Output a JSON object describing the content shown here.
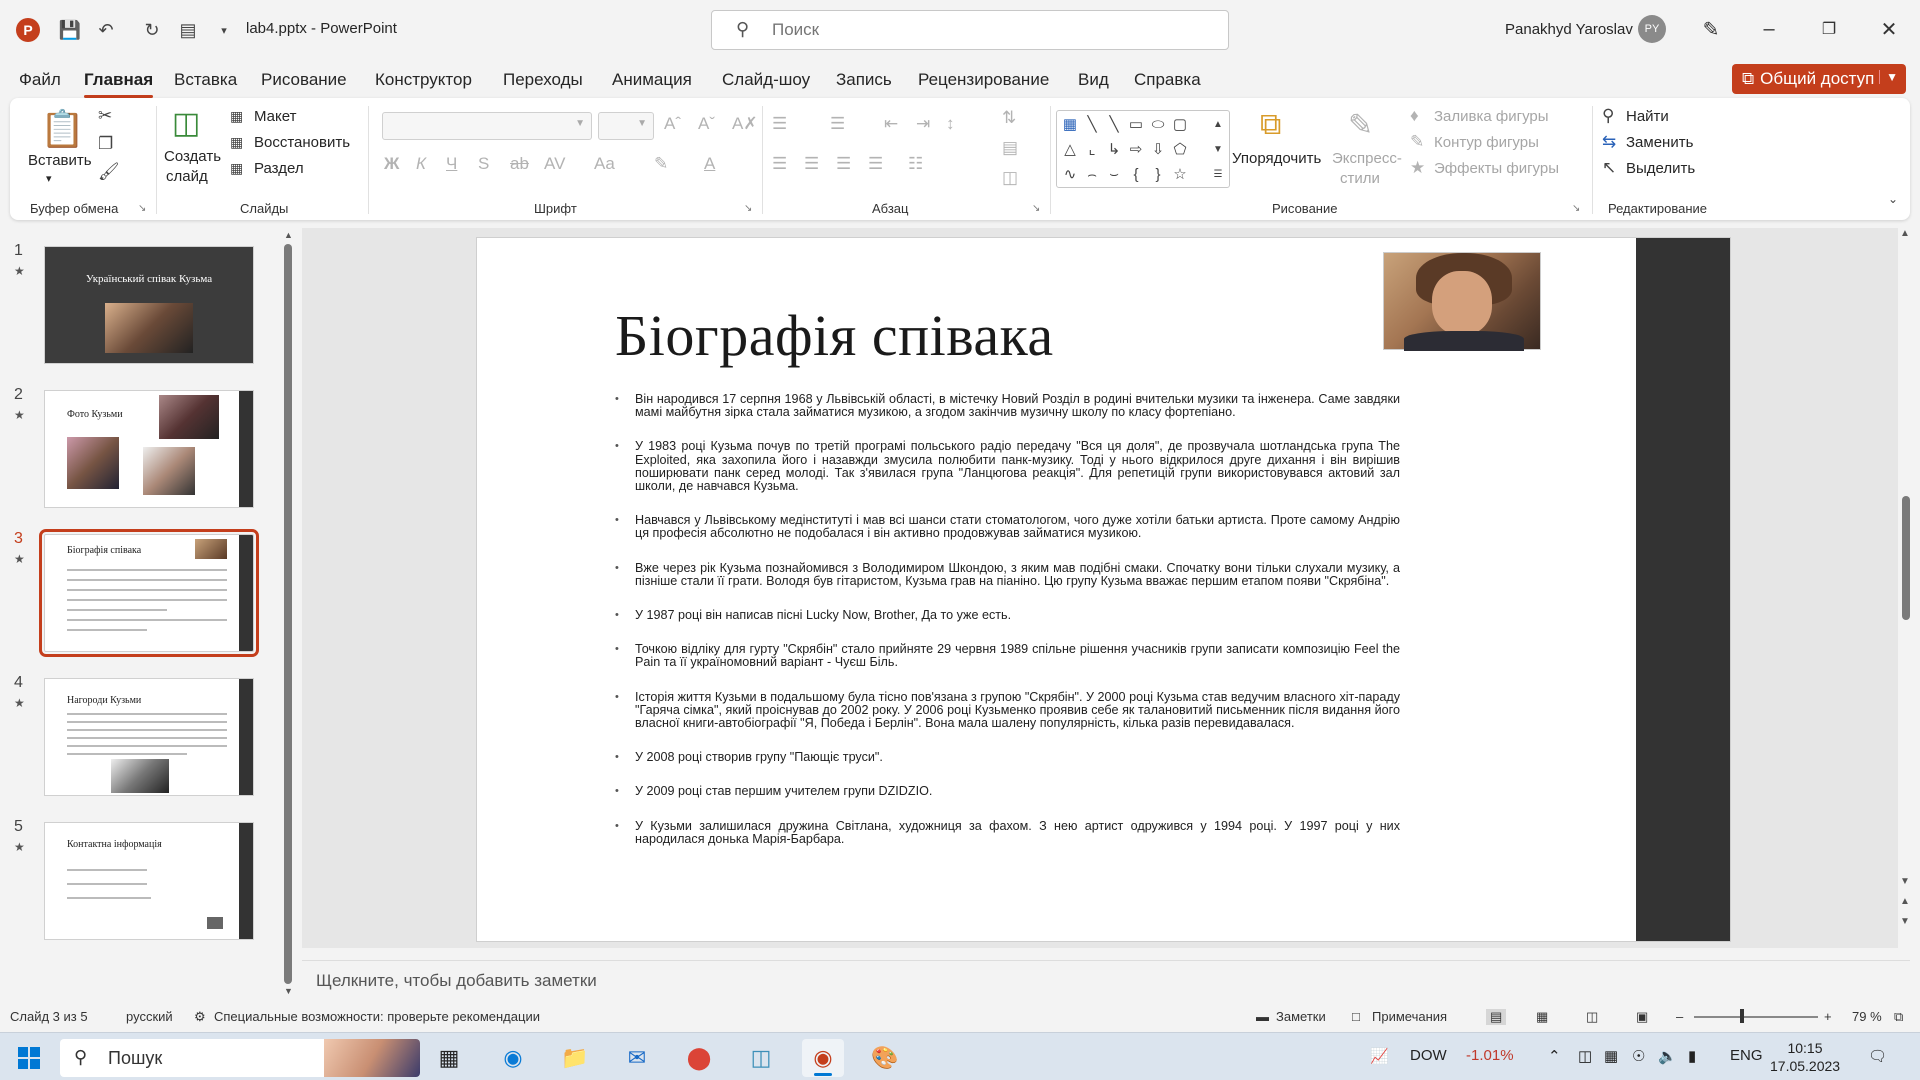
{
  "window": {
    "doc_title": "lab4.pptx  -  PowerPoint",
    "search_placeholder": "Поиск",
    "user_name": "Panakhyd Yaroslav",
    "user_initials": "PY"
  },
  "menu": {
    "tabs": [
      "Файл",
      "Главная",
      "Вставка",
      "Рисование",
      "Конструктор",
      "Переходы",
      "Анимация",
      "Слайд-шоу",
      "Запись",
      "Рецензирование",
      "Вид",
      "Справка"
    ],
    "active_tab": "Главная",
    "share_label": "Общий доступ"
  },
  "ribbon": {
    "clipboard": {
      "paste": "Вставить",
      "group": "Буфер обмена"
    },
    "slides": {
      "new_slide_1": "Создать",
      "new_slide_2": "слайд",
      "layout": "Макет",
      "reset": "Восстановить",
      "section": "Раздел",
      "group": "Слайды"
    },
    "font": {
      "group": "Шрифт"
    },
    "paragraph": {
      "group": "Абзац"
    },
    "drawing": {
      "arrange": "Упорядочить",
      "quick_styles_1": "Экспресс-",
      "quick_styles_2": "стили",
      "fill": "Заливка фигуры",
      "outline": "Контур фигуры",
      "effects": "Эффекты фигуры",
      "group": "Рисование"
    },
    "editing": {
      "find": "Найти",
      "replace": "Заменить",
      "select": "Выделить",
      "group": "Редактирование"
    }
  },
  "thumbnails": [
    {
      "num": "1",
      "title": "Український співак Кузьма"
    },
    {
      "num": "2",
      "title": "Фото Кузьми"
    },
    {
      "num": "3",
      "title": "Біографія співака"
    },
    {
      "num": "4",
      "title": "Нагороди Кузьми"
    },
    {
      "num": "5",
      "title": "Контактна інформація"
    }
  ],
  "slide": {
    "title": "Біографія співака",
    "bullets": [
      "Він народився 17 серпня 1968 у Львівській області, в містечку Новий Розділ в родині вчительки музики та інженера. Саме завдяки мамі майбутня зірка стала займатися музикою, а згодом закінчив музичну школу по класу фортепіано.",
      "У 1983 році Кузьма почув по третій програмі польського радіо передачу \"Вся ця доля\", де прозвучала шотландська група The Exploited, яка захопила його і назавжди змусила полюбити панк-музику. Тоді у нього відкрилося друге дихання і він вирішив поширювати панк серед молоді. Так з'явилася група \"Ланцюгова реакція\". Для репетицій групи використовувався актовий зал школи, де навчався Кузьма.",
      "Навчався у Львівському медінституті і мав всі шанси стати стоматологом, чого дуже хотіли батьки артиста. Проте самому Андрію ця професія абсолютно не подобалася і він активно продовжував займатися музикою.",
      "Вже через рік Кузьма познайомився з Володимиром Шкондою, з яким мав подібні смаки. Спочатку вони тільки слухали музику, а пізніше стали її грати. Володя був гітаристом, Кузьма грав на піаніно. Цю групу Кузьма вважає першим етапом появи \"Скрябіна\".",
      "У 1987 році він написав пісні Lucky Now, Brother, Да то уже есть.",
      "Точкою відліку для гурту \"Скрябін\" стало прийняте 29 червня 1989 спільне рішення учасників групи записати композицію Feel the Pain та її україномовний варіант - Чуєш Біль.",
      "Історія життя Кузьми в подальшому була тісно пов'язана з групою \"Скрябін\". У 2000 році Кузьма став ведучим власного хіт-параду \"Гаряча сімка\", який проіснував до 2002 року. У 2006 році Кузьменко проявив себе як талановитий письменник після видання його власної книги-автобіографії \"Я, Победа і Берлін\". Вона мала шалену популярність, кілька разів перевидавалася.",
      "У 2008 році створив групу \"Пающіє труси\".",
      "У 2009 році став першим учителем групи DZIDZIO.",
      "У Кузьми залишилася дружина Світлана, художниця за фахом. З нею артист одружився у 1994 році. У 1997 році у них народилася донька Марія-Барбара."
    ]
  },
  "notes_placeholder": "Щелкните, чтобы добавить заметки",
  "status": {
    "slide_of": "Слайд 3 из 5",
    "language": "русский",
    "accessibility": "Специальные возможности: проверьте рекомендации",
    "notes_btn": "Заметки",
    "comments_btn": "Примечания",
    "zoom": "79 %"
  },
  "taskbar": {
    "search_label": "Пошук",
    "stock_name": "DOW",
    "stock_change": "-1.01%",
    "lang": "ENG",
    "time": "10:15",
    "date": "17.05.2023"
  },
  "colors": {
    "accent": "#c43e1c",
    "slide_bar": "#333333"
  }
}
